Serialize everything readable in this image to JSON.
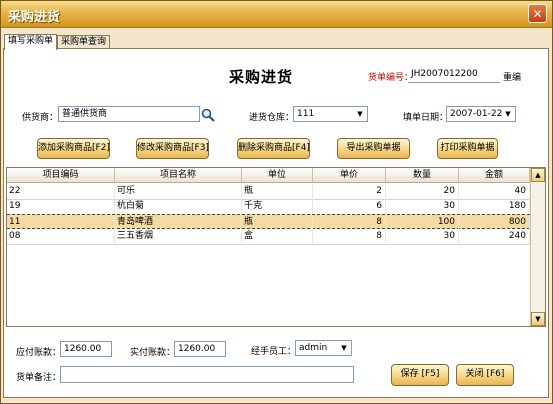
{
  "window": {
    "title": "采购进货",
    "close_glyph": "✕"
  },
  "tabs": [
    {
      "label": "填写采购单",
      "active": true
    },
    {
      "label": "采购单查询",
      "active": false
    }
  ],
  "form": {
    "heading": "采购进货",
    "order_no_label": "货单编号：",
    "order_no_value": "JH2007012200",
    "regenerate_label": "重编",
    "supplier_label": "供货商：",
    "supplier_value": "普通供货商",
    "warehouse_label": "进货仓库：",
    "warehouse_value": "111",
    "date_label": "填单日期：",
    "date_value": "2007-01-22"
  },
  "toolbar": {
    "add_label": "添加采购商品[F2]",
    "edit_label": "修改采购商品[F3]",
    "delete_label": "删除采购商品[F4]",
    "export_label": "导出采购单据",
    "print_label": "打印采购单据"
  },
  "table": {
    "columns": [
      "项目编码",
      "项目名称",
      "单位",
      "单价",
      "数量",
      "金额"
    ],
    "rows": [
      {
        "code": "22",
        "name": "可乐",
        "unit": "瓶",
        "price": "2",
        "qty": "20",
        "amount": "40",
        "selected": false
      },
      {
        "code": "19",
        "name": "杭白菊",
        "unit": "千克",
        "price": "6",
        "qty": "30",
        "amount": "180",
        "selected": false
      },
      {
        "code": "11",
        "name": "青岛啤酒",
        "unit": "瓶",
        "price": "8",
        "qty": "100",
        "amount": "800",
        "selected": true
      },
      {
        "code": "08",
        "name": "三五香烟",
        "unit": "盒",
        "price": "8",
        "qty": "30",
        "amount": "240",
        "selected": false
      }
    ],
    "scroll_up_glyph": "▲",
    "scroll_down_glyph": "▼"
  },
  "footer": {
    "payable_label": "应付账款：",
    "payable_value": "1260.00",
    "paid_label": "实付账款：",
    "paid_value": "1260.00",
    "handler_label": "经手员工：",
    "handler_value": "admin",
    "remark_label": "货单备注：",
    "remark_value": "",
    "save_label": "保存 [F5]",
    "close_label": "关闭 [F6]"
  },
  "dropdown_glyph": "▼",
  "colors": {
    "title_gradient_top": "#f7dd8f",
    "title_gradient_bottom": "#d49419",
    "selected_row": "#f7d9a3",
    "order_label": "#d00000"
  }
}
